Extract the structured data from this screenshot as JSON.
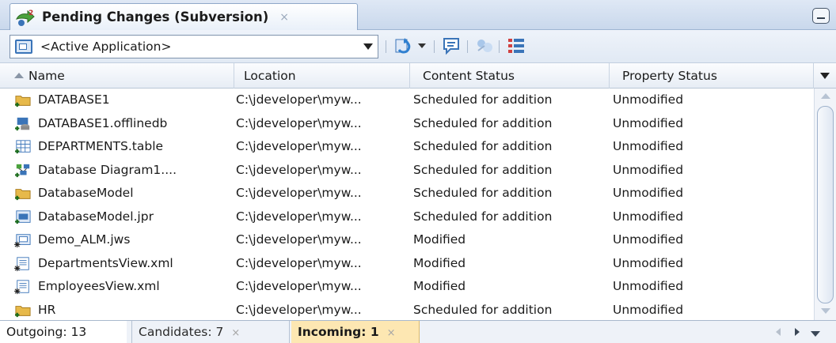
{
  "window": {
    "tab_title": "Pending Changes (Subversion)",
    "tab_close": "×"
  },
  "toolbar": {
    "scope_value": "<Active Application>"
  },
  "table": {
    "columns": [
      "Name",
      "Location",
      "Content Status",
      "Property Status"
    ],
    "sorted_column": "Name",
    "rows": [
      {
        "icon": "folder-add-icon",
        "name": "DATABASE1",
        "location": "C:\\jdeveloper\\myw...",
        "content": "Scheduled for addition",
        "property": "Unmodified"
      },
      {
        "icon": "offline-db-icon",
        "name": "DATABASE1.offlinedb",
        "location": "C:\\jdeveloper\\myw...",
        "content": "Scheduled for addition",
        "property": "Unmodified"
      },
      {
        "icon": "table-icon",
        "name": "DEPARTMENTS.table",
        "location": "C:\\jdeveloper\\myw...",
        "content": "Scheduled for addition",
        "property": "Unmodified"
      },
      {
        "icon": "diagram-icon",
        "name": "Database Diagram1....",
        "location": "C:\\jdeveloper\\myw...",
        "content": "Scheduled for addition",
        "property": "Unmodified"
      },
      {
        "icon": "folder-add-icon",
        "name": "DatabaseModel",
        "location": "C:\\jdeveloper\\myw...",
        "content": "Scheduled for addition",
        "property": "Unmodified"
      },
      {
        "icon": "project-icon",
        "name": "DatabaseModel.jpr",
        "location": "C:\\jdeveloper\\myw...",
        "content": "Scheduled for addition",
        "property": "Unmodified"
      },
      {
        "icon": "workspace-modified-icon",
        "name": "Demo_ALM.jws",
        "location": "C:\\jdeveloper\\myw...",
        "content": "Modified",
        "property": "Unmodified"
      },
      {
        "icon": "view-object-modified-icon",
        "name": "DepartmentsView.xml",
        "location": "C:\\jdeveloper\\myw...",
        "content": "Modified",
        "property": "Unmodified"
      },
      {
        "icon": "view-object-modified-icon",
        "name": "EmployeesView.xml",
        "location": "C:\\jdeveloper\\myw...",
        "content": "Modified",
        "property": "Unmodified"
      },
      {
        "icon": "folder-add-icon",
        "name": "HR",
        "location": "C:\\jdeveloper\\myw...",
        "content": "Scheduled for addition",
        "property": "Unmodified"
      }
    ]
  },
  "bottom_tabs": {
    "outgoing": "Outgoing: 13",
    "candidates": "Candidates: 7",
    "incoming": "Incoming: 1",
    "close": "×"
  },
  "colors": {
    "accent": "#3a74b8",
    "incoming_tab_bg": "#fde7b2",
    "folder": "#e7b94a"
  }
}
